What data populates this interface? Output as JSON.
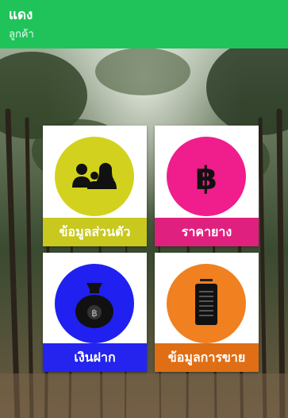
{
  "header": {
    "title": "แดง",
    "subtitle": "ลูกค้า",
    "color": "#1fc35a"
  },
  "menu": [
    {
      "label": "ข้อมูลส่วนตัว",
      "icon": "people-icon",
      "circle_color": "#d2d21e",
      "label_color": "#c8c81e"
    },
    {
      "label": "ราคายาง",
      "icon": "baht-icon",
      "circle_color": "#f01e8c",
      "label_color": "#e0207e"
    },
    {
      "label": "เงินฝาก",
      "icon": "money-bag-icon",
      "circle_color": "#2020f0",
      "label_color": "#2424ee"
    },
    {
      "label": "ข้อมูลการขาย",
      "icon": "document-icon",
      "circle_color": "#f08020",
      "label_color": "#e06e14"
    }
  ]
}
